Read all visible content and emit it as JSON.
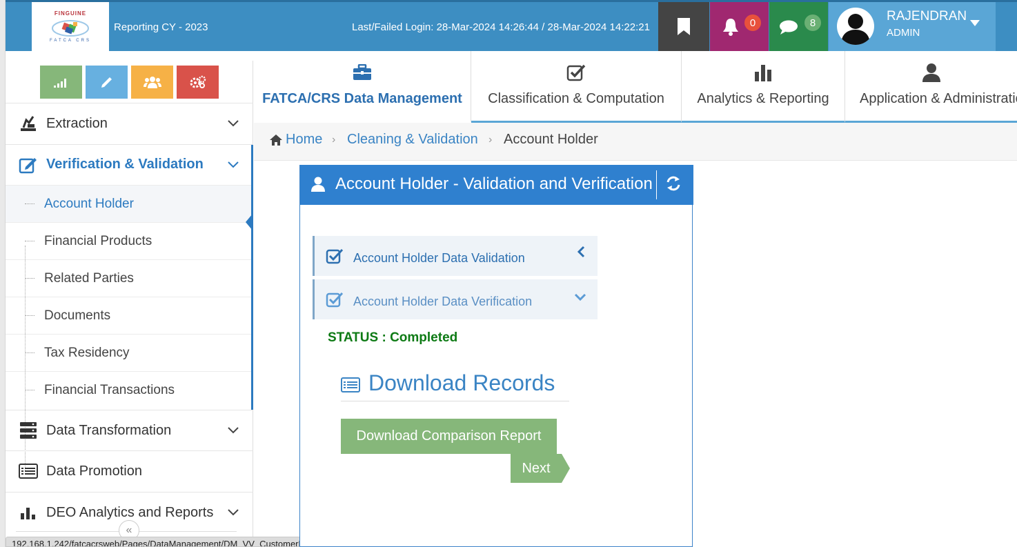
{
  "header": {
    "logo": {
      "top_text": "FINGUINE",
      "bottom_text": "FATCA CRS"
    },
    "reporting": "Reporting CY - 2023",
    "last_login": "Last/Failed Login: 28-Mar-2024 14:26:44 / 28-Mar-2024 14:22:21",
    "notifications_count": "0",
    "messages_count": "8",
    "user": {
      "name": "RAJENDRAN",
      "role": "ADMIN"
    },
    "colors": {
      "bar": "#3d8ec2",
      "bookmark": "#444444",
      "bell": "#a02870",
      "chat": "#2a8a4c",
      "user": "#5aa6d6"
    }
  },
  "quick_buttons": [
    {
      "icon": "signal-icon",
      "color": "#86b77a"
    },
    {
      "icon": "pencil-icon",
      "color": "#67b0e0"
    },
    {
      "icon": "users-icon",
      "color": "#f6b146"
    },
    {
      "icon": "gears-icon",
      "color": "#d9524a"
    }
  ],
  "sidebar": {
    "items": [
      {
        "label": "Extraction",
        "icon": "extraction-icon"
      },
      {
        "label": "Verification & Validation",
        "icon": "edit-icon"
      },
      {
        "label": "Data Transformation",
        "icon": "server-icon"
      },
      {
        "label": "Data Promotion",
        "icon": "list-icon"
      },
      {
        "label": "DEO Analytics and Reports",
        "icon": "bar-chart-icon"
      }
    ],
    "subitems": [
      {
        "label": "Account Holder"
      },
      {
        "label": "Financial Products"
      },
      {
        "label": "Related Parties"
      },
      {
        "label": "Documents"
      },
      {
        "label": "Tax Residency"
      },
      {
        "label": "Financial Transactions"
      }
    ]
  },
  "status_url": "192.168.1.242/fatcacrsweb/Pages/DataManagement/DM_VV_CustomerData.aspx#fm_1_22",
  "tabs": [
    {
      "label": "FATCA/CRS Data Management",
      "icon": "briefcase-icon"
    },
    {
      "label": "Classification & Computation",
      "icon": "check-square-icon"
    },
    {
      "label": "Analytics & Reporting",
      "icon": "bar-chart-icon"
    },
    {
      "label": "Application & Administration",
      "icon": "user-icon"
    }
  ],
  "breadcrumb": {
    "home": "Home",
    "parent": "Cleaning & Validation",
    "current": "Account Holder"
  },
  "panel": {
    "title": "Account Holder - Validation and Verification",
    "sections": [
      {
        "label": "Account Holder Data Validation"
      },
      {
        "label": "Account Holder Data Verification"
      }
    ],
    "status": "STATUS : Completed",
    "download_title": "Download Records",
    "download_button": "Download Comparison Report",
    "next_button": "Next"
  }
}
